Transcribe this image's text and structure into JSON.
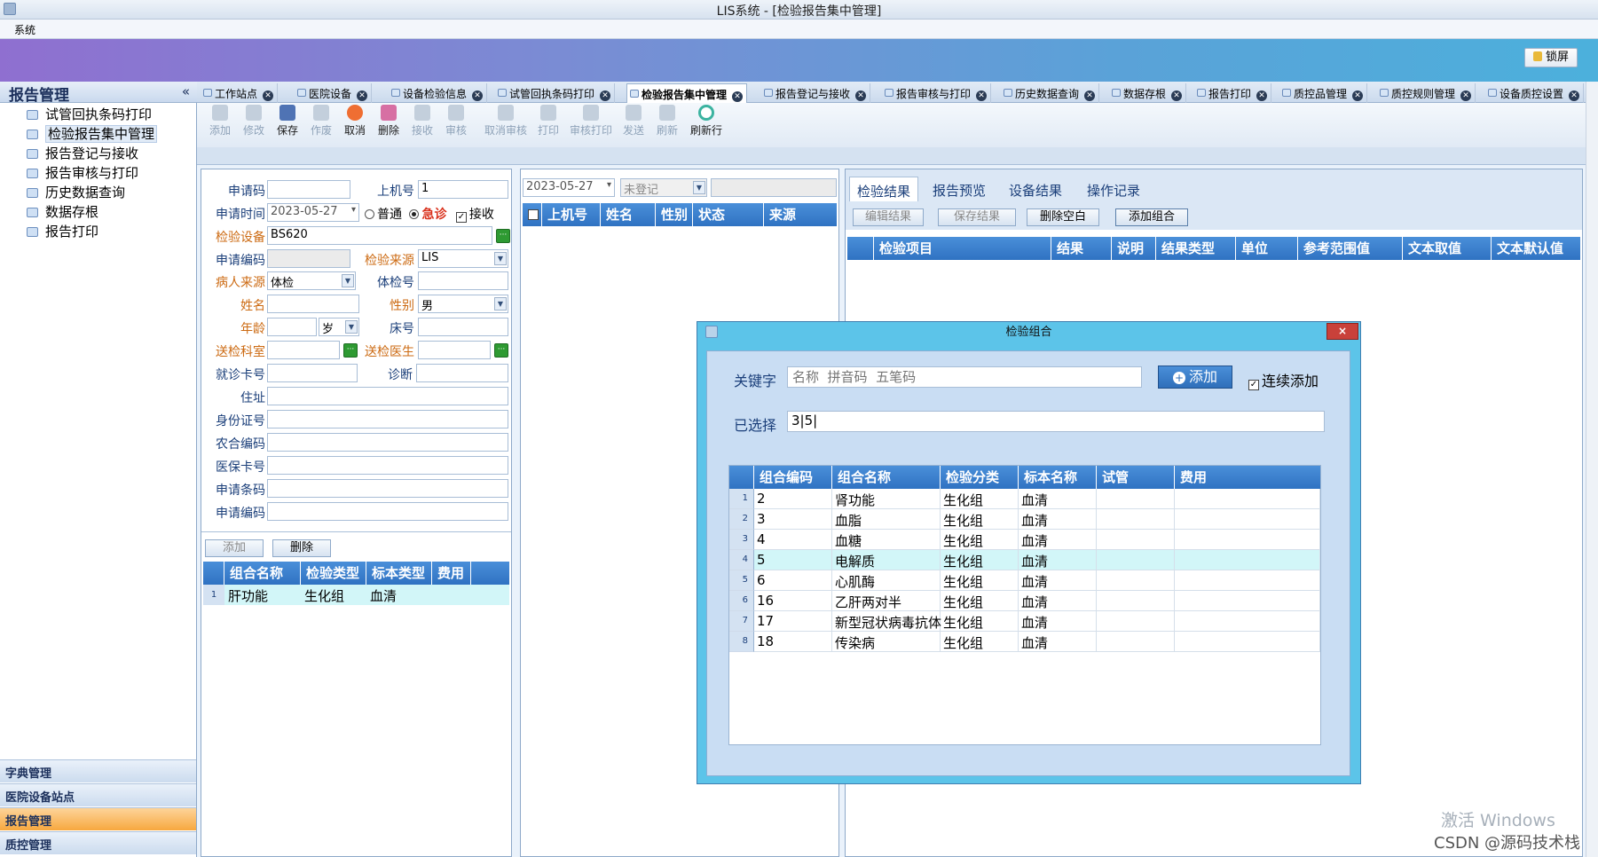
{
  "window": {
    "title": "LIS系统 - [检验报告集中管理]"
  },
  "menu": {
    "system": "系统"
  },
  "lock": {
    "label": "锁屏"
  },
  "left": {
    "header": "报告管理",
    "collapse": "«",
    "items": [
      "试管回执条码打印",
      "检验报告集中管理",
      "报告登记与接收",
      "报告审核与打印",
      "历史数据查询",
      "数据存根",
      "报告打印"
    ],
    "accordions": [
      "字典管理",
      "医院设备站点",
      "报告管理",
      "质控管理"
    ]
  },
  "tabs": [
    "工作站点",
    "医院设备",
    "设备检验信息",
    "试管回执条码打印",
    "检验报告集中管理",
    "报告登记与接收",
    "报告审核与打印",
    "历史数据查询",
    "数据存根",
    "报告打印",
    "质控品管理",
    "质控规则管理",
    "设备质控设置"
  ],
  "toolbar": [
    "添加",
    "修改",
    "保存",
    "作废",
    "取消",
    "删除",
    "接收",
    "审核",
    "取消审核",
    "打印",
    "审核打印",
    "发送",
    "刷新",
    "刷新行"
  ],
  "form": {
    "apply_code_label": "申请码",
    "machine_no_label": "上机号",
    "machine_no_value": "1",
    "apply_time_label": "申请时间",
    "apply_time_value": "2023-05-27",
    "normal_label": "普通",
    "urgent_label": "急诊",
    "receive_label": "接收",
    "device_label": "检验设备",
    "device_value": "BS620",
    "apply_no_label": "申请编码",
    "source_label": "检验来源",
    "source_value": "LIS",
    "patient_source_label": "病人来源",
    "patient_source_value": "体检",
    "exam_no_label": "体检号",
    "name_label": "姓名",
    "gender_label": "性别",
    "gender_value": "男",
    "age_label": "年龄",
    "age_unit": "岁",
    "bed_label": "床号",
    "dept_label": "送检科室",
    "doctor_label": "送检医生",
    "card_label": "就诊卡号",
    "diagnosis_label": "诊断",
    "address_label": "住址",
    "id_label": "身份证号",
    "nh_label": "农合编码",
    "insurance_label": "医保卡号",
    "barcode_label": "申请条码",
    "apply_code2_label": "申请编码",
    "add_btn": "添加",
    "del_btn": "删除",
    "grid_headers": [
      "组合名称",
      "检验类型",
      "标本类型",
      "费用"
    ],
    "grid_rows": [
      {
        "n": "1",
        "name": "肝功能",
        "type": "生化组",
        "sample": "血清",
        "fee": ""
      }
    ]
  },
  "middle": {
    "date": "2023-05-27",
    "status": "未登记",
    "headers": [
      "上机号",
      "姓名",
      "性别",
      "状态",
      "来源"
    ]
  },
  "right": {
    "tabs": [
      "检验结果",
      "报告预览",
      "设备结果",
      "操作记录"
    ],
    "buttons": [
      "编辑结果",
      "保存结果",
      "删除空白",
      "添加组合"
    ],
    "headers": [
      "检验项目",
      "结果",
      "说明",
      "结果类型",
      "单位",
      "参考范围值",
      "文本取值",
      "文本默认值"
    ]
  },
  "dialog": {
    "title": "检验组合",
    "close": "×",
    "keyword_label": "关键字",
    "keyword_placeholder": "名称  拼音码  五笔码",
    "add_btn": "添加",
    "continuous_label": "连续添加",
    "selected_label": "已选择",
    "selected_value": "3|5|",
    "headers": [
      "组合编码",
      "组合名称",
      "检验分类",
      "标本名称",
      "试管",
      "费用"
    ],
    "rows": [
      {
        "n": "1",
        "code": "2",
        "name": "肾功能",
        "cat": "生化组",
        "sample": "血清"
      },
      {
        "n": "2",
        "code": "3",
        "name": "血脂",
        "cat": "生化组",
        "sample": "血清"
      },
      {
        "n": "3",
        "code": "4",
        "name": "血糖",
        "cat": "生化组",
        "sample": "血清"
      },
      {
        "n": "4",
        "code": "5",
        "name": "电解质",
        "cat": "生化组",
        "sample": "血清"
      },
      {
        "n": "5",
        "code": "6",
        "name": "心肌酶",
        "cat": "生化组",
        "sample": "血清"
      },
      {
        "n": "6",
        "code": "16",
        "name": "乙肝两对半",
        "cat": "生化组",
        "sample": "血清"
      },
      {
        "n": "7",
        "code": "17",
        "name": "新型冠状病毒抗体",
        "cat": "生化组",
        "sample": "血清"
      },
      {
        "n": "8",
        "code": "18",
        "name": "传染病",
        "cat": "生化组",
        "sample": "血清"
      }
    ]
  },
  "watermark": {
    "line1": "激活 Windows",
    "line2": "CSDN @源码技术栈"
  }
}
